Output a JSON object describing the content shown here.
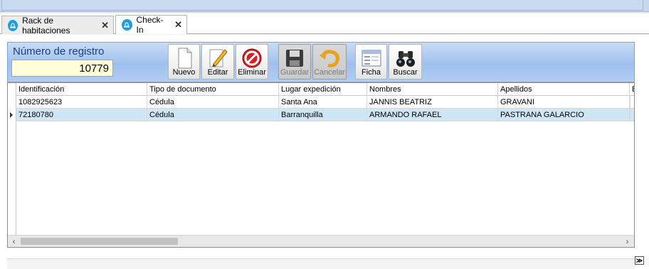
{
  "tabs": [
    {
      "label": "Rack de habitaciones",
      "close": "✕",
      "active": false
    },
    {
      "label": "Check-In",
      "close": "✕",
      "active": true
    }
  ],
  "registro": {
    "label": "Número de registro",
    "value": "10779"
  },
  "toolbar": {
    "nuevo": "Nuevo",
    "editar": "Editar",
    "eliminar": "Eliminar",
    "guardar": "Guardar",
    "cancelar": "Cancelar",
    "ficha": "Ficha",
    "buscar": "Buscar"
  },
  "grid": {
    "columns": [
      "Identificación",
      "Tipo de documento",
      "Lugar expedición",
      "Nombres",
      "Apellidos",
      "E"
    ],
    "rows": [
      {
        "id": "1082925623",
        "tipo": "Cédula",
        "lugar": "Santa Ana",
        "nombres": "JANNIS BEATRIZ",
        "apellidos": "GRAVANI"
      },
      {
        "id": "72180780",
        "tipo": "Cédula",
        "lugar": "Barranquilla",
        "nombres": "ARMANDO RAFAEL",
        "apellidos": "PASTRANA GALARCIO"
      }
    ],
    "selected_row": 1
  },
  "scroll": {
    "left": "‹",
    "right": "›"
  },
  "collapse": "≫"
}
